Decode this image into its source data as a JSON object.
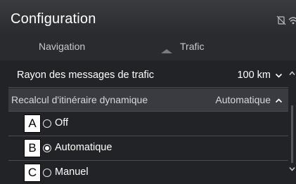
{
  "header": {
    "title": "Configuration",
    "status_icons": [
      "phone-off-icon",
      "signal-icon"
    ]
  },
  "tabs": [
    {
      "label": "Navigation",
      "active": false
    },
    {
      "label": "Trafic",
      "active": true
    }
  ],
  "settings": {
    "radius": {
      "label": "Rayon des messages de trafic",
      "value": "100 km"
    },
    "dynamic": {
      "label": "Recalcul d'itinéraire dynamique",
      "value": "Automatique"
    }
  },
  "options": [
    {
      "letter": "A",
      "label": "Off",
      "selected": false
    },
    {
      "letter": "B",
      "label": "Automatique",
      "selected": true
    },
    {
      "letter": "C",
      "label": "Manuel",
      "selected": false
    }
  ],
  "colors": {
    "background": "#222326",
    "text": "#ffffff",
    "divider": "#4a4b50",
    "highlight_row": "#3a3b40"
  }
}
